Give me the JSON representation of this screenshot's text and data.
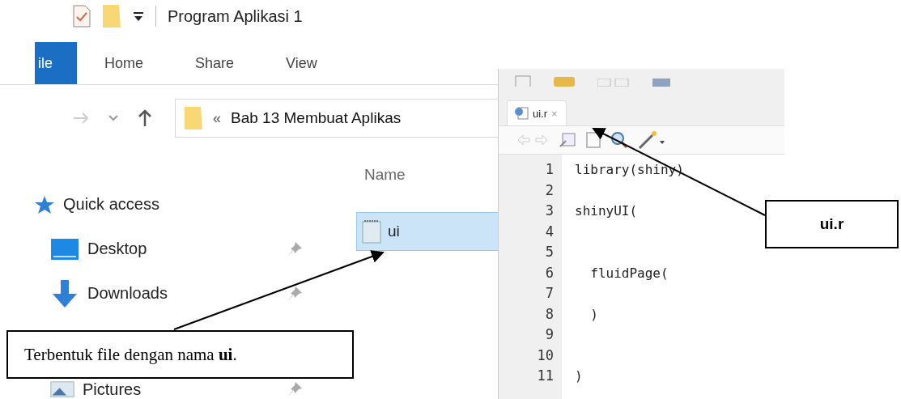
{
  "window": {
    "title": "Program Aplikasi 1"
  },
  "ribbon_tabs": [
    {
      "label": "ile",
      "selected": true
    },
    {
      "label": "Home",
      "selected": false
    },
    {
      "label": "Share",
      "selected": false
    },
    {
      "label": "View",
      "selected": false
    }
  ],
  "address_bar": {
    "separator": "«",
    "path": "Bab 13 Membuat Aplikas"
  },
  "sidebar": {
    "items": [
      {
        "kind": "quick-access",
        "label": "Quick access",
        "pinned": false
      },
      {
        "kind": "desktop",
        "label": "Desktop",
        "pinned": true
      },
      {
        "kind": "downloads",
        "label": "Downloads",
        "pinned": true
      },
      {
        "kind": "pictures",
        "label": "Pictures",
        "pinned": true
      }
    ]
  },
  "file_list": {
    "column": "Name",
    "files": [
      {
        "name": "ui",
        "selected": true
      }
    ]
  },
  "editor": {
    "tab": {
      "label": "ui.r",
      "close": "×"
    },
    "lines": [
      {
        "number": "1",
        "code": "library(shiny)"
      },
      {
        "number": "2"
      },
      {
        "number": "3",
        "code": "shinyUI("
      },
      {
        "number": "4"
      },
      {
        "number": "5"
      },
      {
        "number": "6",
        "code": "  fluidPage("
      },
      {
        "number": "7"
      },
      {
        "number": "8",
        "code": "  )"
      },
      {
        "number": "9"
      },
      {
        "number": "10"
      },
      {
        "number": "11",
        "code": ")"
      }
    ]
  },
  "callouts": [
    {
      "text": "Terbentuk file dengan nama **ui**.",
      "kind": "file"
    },
    {
      "text": "ui.r",
      "kind": "tab"
    }
  ]
}
